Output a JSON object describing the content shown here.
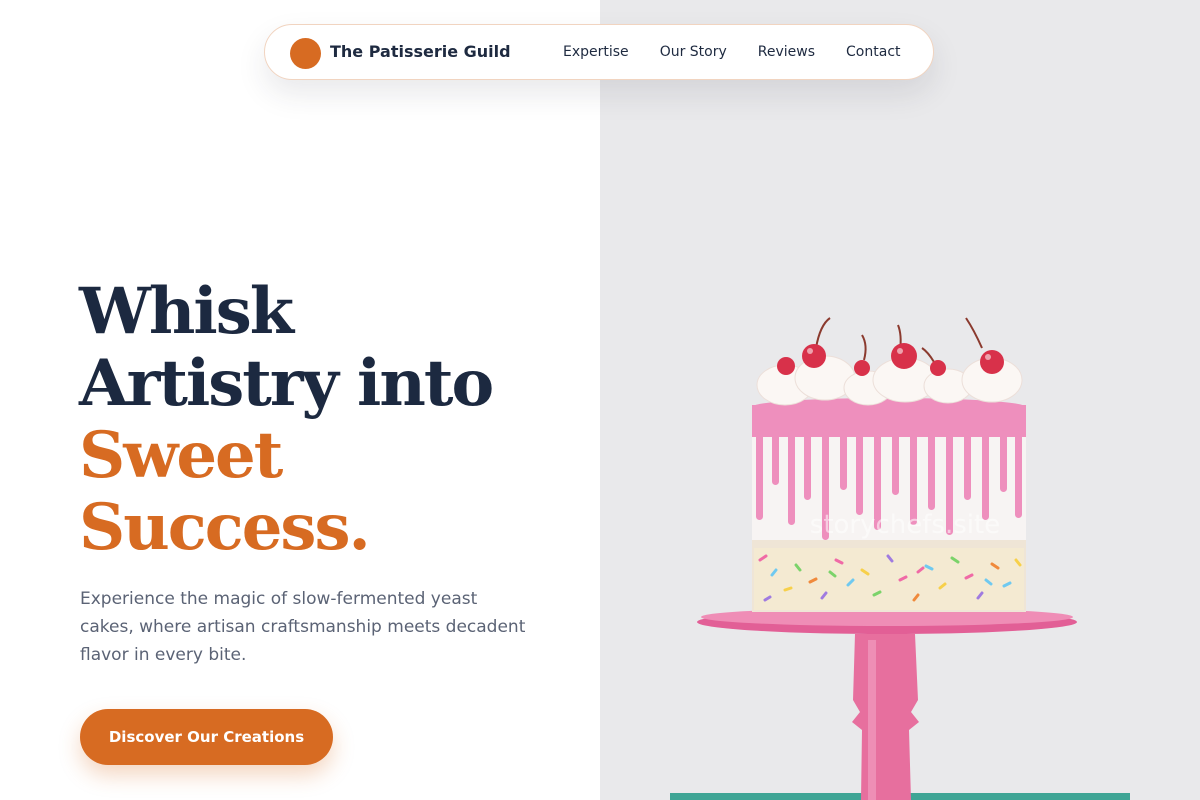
{
  "brand": {
    "name": "The Patisserie Guild"
  },
  "nav": {
    "links": [
      {
        "label": "Expertise"
      },
      {
        "label": "Our Story"
      },
      {
        "label": "Reviews"
      },
      {
        "label": "Contact"
      }
    ]
  },
  "hero": {
    "headline_line1": "Whisk",
    "headline_line2": "Artistry into",
    "headline_accent1": "Sweet",
    "headline_accent2": "Success.",
    "subtext": "Experience the magic of slow-fermented yeast cakes, where artisan craftsmanship meets decadent flavor in every bite.",
    "cta_label": "Discover Our Creations"
  },
  "image": {
    "watermark": "storychefs.site"
  },
  "colors": {
    "accent": "#d76b22",
    "heading": "#1c2940",
    "body_text": "#5b6375",
    "panel_bg": "#e9e9eb",
    "cake_drip": "#ee8fbd",
    "cake_stand": "#e76f9e"
  }
}
